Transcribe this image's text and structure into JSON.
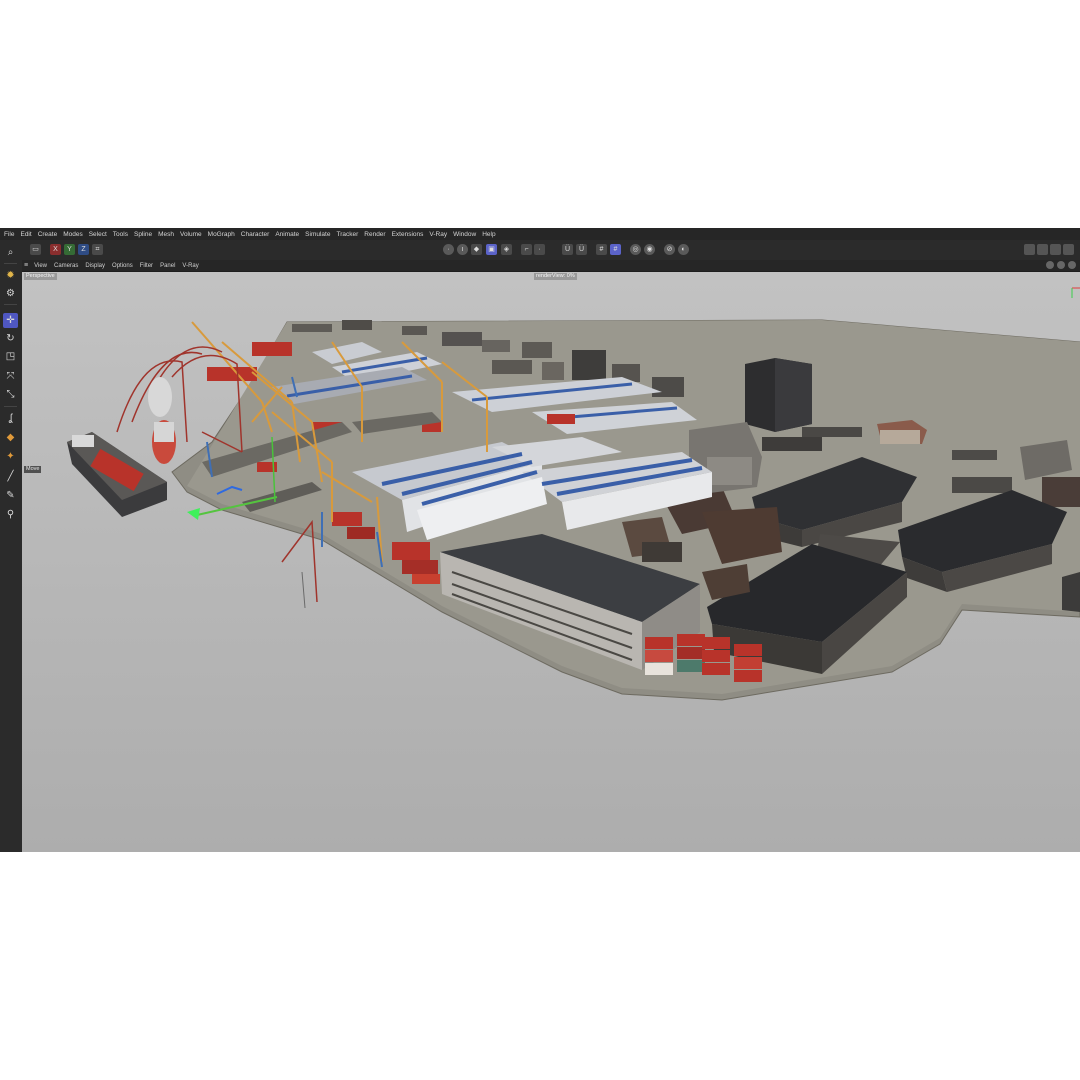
{
  "menu": [
    "File",
    "Edit",
    "Create",
    "Modes",
    "Select",
    "Tools",
    "Spline",
    "Mesh",
    "Volume",
    "MoGraph",
    "Character",
    "Animate",
    "Simulate",
    "Tracker",
    "Render",
    "Extensions",
    "V-Ray",
    "Window",
    "Help"
  ],
  "toolbar": {
    "axis_x": "X",
    "axis_y": "Y",
    "axis_z": "Z"
  },
  "view_menu": [
    "View",
    "Cameras",
    "Display",
    "Options",
    "Filter",
    "Panel",
    "V-Ray"
  ],
  "viewport": {
    "camera_label": "Perspective",
    "center_label": "renderView: 0%",
    "tool_label": "Move"
  },
  "colors": {
    "accent": "#4f57c2",
    "viewport_bg": "#b6b6b6",
    "ground": "#8f8d84",
    "container_red": "#b8332a"
  },
  "icons": {
    "palette": [
      "search-icon",
      "live-selection-icon",
      "settings-icon",
      "move-icon",
      "rotate-icon",
      "scale-icon",
      "transform-icon",
      "snap-icon",
      "spline-pen-icon",
      "paint-icon",
      "brush-icon",
      "eyedropper-icon",
      "layer-icon"
    ]
  }
}
